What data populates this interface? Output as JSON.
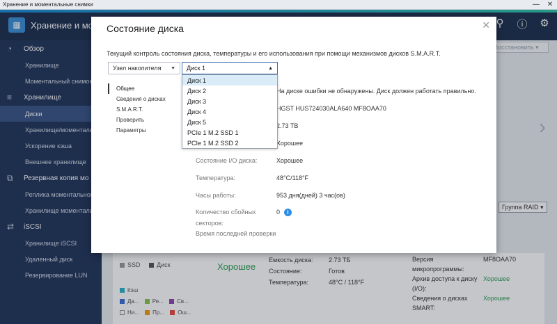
{
  "window": {
    "title": "Хранение и моментальные снимки",
    "minimize": "—",
    "close": "✕"
  },
  "app": {
    "title": "Хранение и моме",
    "icons": [
      "search-icon",
      "help-icon",
      "gear-icon"
    ]
  },
  "sidebar": {
    "sections": [
      {
        "label": "Обзор",
        "icon": "dashboard-icon",
        "items": [
          "Хранилище",
          "Моментальный снимок"
        ]
      },
      {
        "label": "Хранилище",
        "icon": "database-icon",
        "items": [
          "Диски",
          "Хранилище/моментальн",
          "Ускорение кэша",
          "Внешнее хранилище"
        ]
      },
      {
        "label": "Резервная копия мо",
        "icon": "backup-icon",
        "items": [
          "Реплика моментального",
          "Хранилище моментальн"
        ]
      },
      {
        "label": "iSCSI",
        "icon": "iscsi-icon",
        "items": [
          "Хранилище iSCSI",
          "Удаленный диск",
          "Резервирование LUN"
        ]
      }
    ],
    "active_item": "Диски"
  },
  "background": {
    "restore_label": "Восстановить",
    "raid_group_label": "Группа RAID",
    "legend": {
      "ssd": "SSD",
      "disk": "Диск",
      "cache": "Кэш"
    },
    "mini_legend": [
      "Да...",
      "Ре...",
      "Св...",
      "Ни...",
      "Пр...",
      "Ош..."
    ],
    "status_good": "Хорошее",
    "mid_rows": [
      {
        "k": "Емкость диска:",
        "v": "2.73 ТБ"
      },
      {
        "k": "Состояние:",
        "v": "Готов"
      },
      {
        "k": "Температура:",
        "v": "48°C / 118°F"
      }
    ],
    "right_rows": [
      {
        "k": "Версия микропрограммы:",
        "v": "MF8OAA70"
      },
      {
        "k": "Архив доступа к диску (I/O):",
        "v": "Хорошее"
      },
      {
        "k": "Сведения о дисках SMART:",
        "v": "Хорошее"
      }
    ],
    "right_partial": [
      "а",
      "в"
    ]
  },
  "modal": {
    "title": "Состояние диска",
    "description": "Текущий контроль состояния диска, температуры и его использования при помощи механизмов дисков S.M.A.R.T.",
    "node_select": "Узел накопителя",
    "disk_select": "Диск 1",
    "tabs": [
      "Общее",
      "Сведения о дисках",
      "S.M.A.R.T.",
      "Проверить",
      "Параметры"
    ],
    "info_rows": [
      {
        "k": "",
        "v": "На диске ошибки не обнаружены. Диск должен работать правильно."
      },
      {
        "k": "",
        "v": "HGST HUS724030ALA640 MF8OAA70"
      },
      {
        "k": "",
        "v": "2.73 TB"
      },
      {
        "k": "",
        "v": "Хорошее"
      },
      {
        "k": "Состояние I/O диска:",
        "v": "Хорошее"
      },
      {
        "k": "Температура:",
        "v": "48°C/118°F"
      },
      {
        "k": "Часы работы:",
        "v": "953 дня(дней) 3 час(ов)"
      }
    ],
    "bad_sectors_label": "Количество сбойных секторов:",
    "bad_sectors_value": "0",
    "cut_row": "Время последней проверки"
  },
  "dropdown": {
    "options": [
      "Диск 1",
      "Диск 2",
      "Диск 3",
      "Диск 4",
      "Диск 5",
      "PCIe 1 M.2 SSD 1",
      "PCIe 1 M.2 SSD 2"
    ],
    "selected_index": 0
  },
  "colors": {
    "good": "#2e9d4f",
    "accent": "#2d8ee5",
    "sidebar": "#223559",
    "sidebar_active": "#3a5585"
  }
}
